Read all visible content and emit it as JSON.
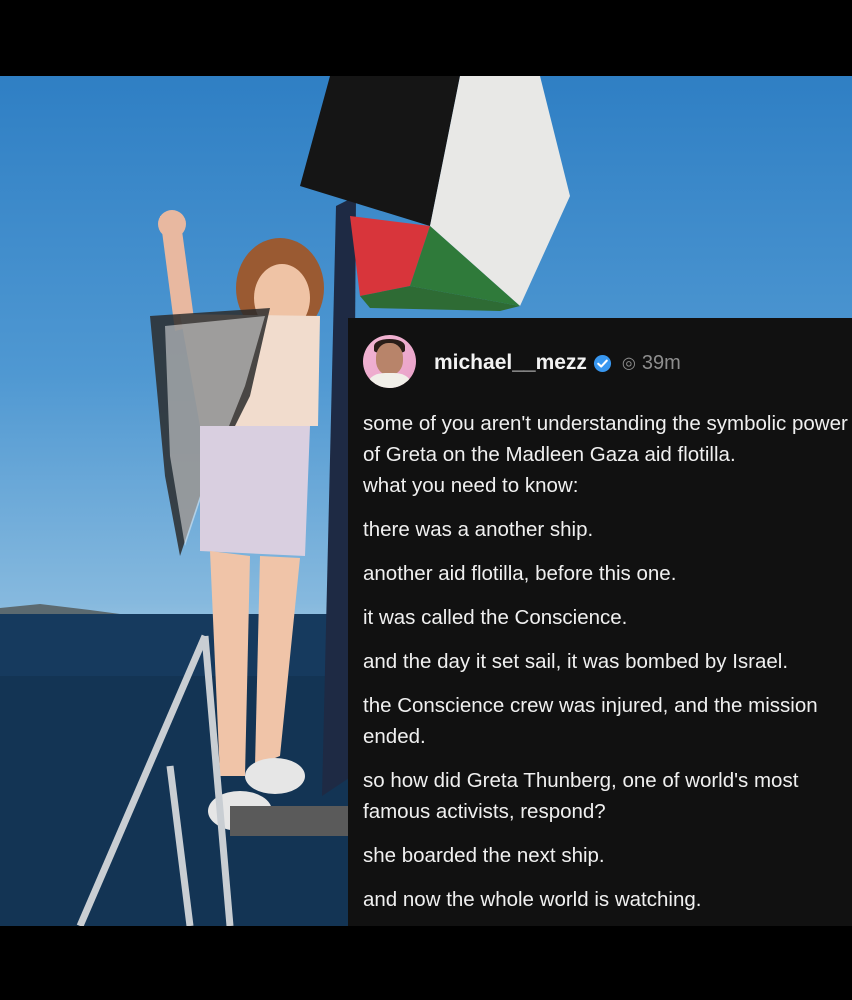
{
  "post": {
    "username": "michael__mezz",
    "time": "39m",
    "verified_icon": "verified-badge-icon",
    "platform_icon": "threads-icon",
    "paragraphs": [
      "some of you aren't understanding the symbolic power of Greta on the Madleen Gaza aid flotilla.\nwhat you need to know:",
      "there was a another ship.",
      "another aid flotilla, before this one.",
      "it was called the Conscience.",
      "and the day it set sail, it was bombed by Israel.",
      "the Conscience crew was injured, and the mission ended.",
      "so how did Greta Thunberg, one of world's most famous activists, respond?",
      "she boarded the next ship.",
      "and now the whole world is watching."
    ]
  },
  "colors": {
    "card_background": "#111111",
    "verified_blue": "#3897f0",
    "meta_gray": "#8e8e8e",
    "text": "#f0f0f0"
  }
}
